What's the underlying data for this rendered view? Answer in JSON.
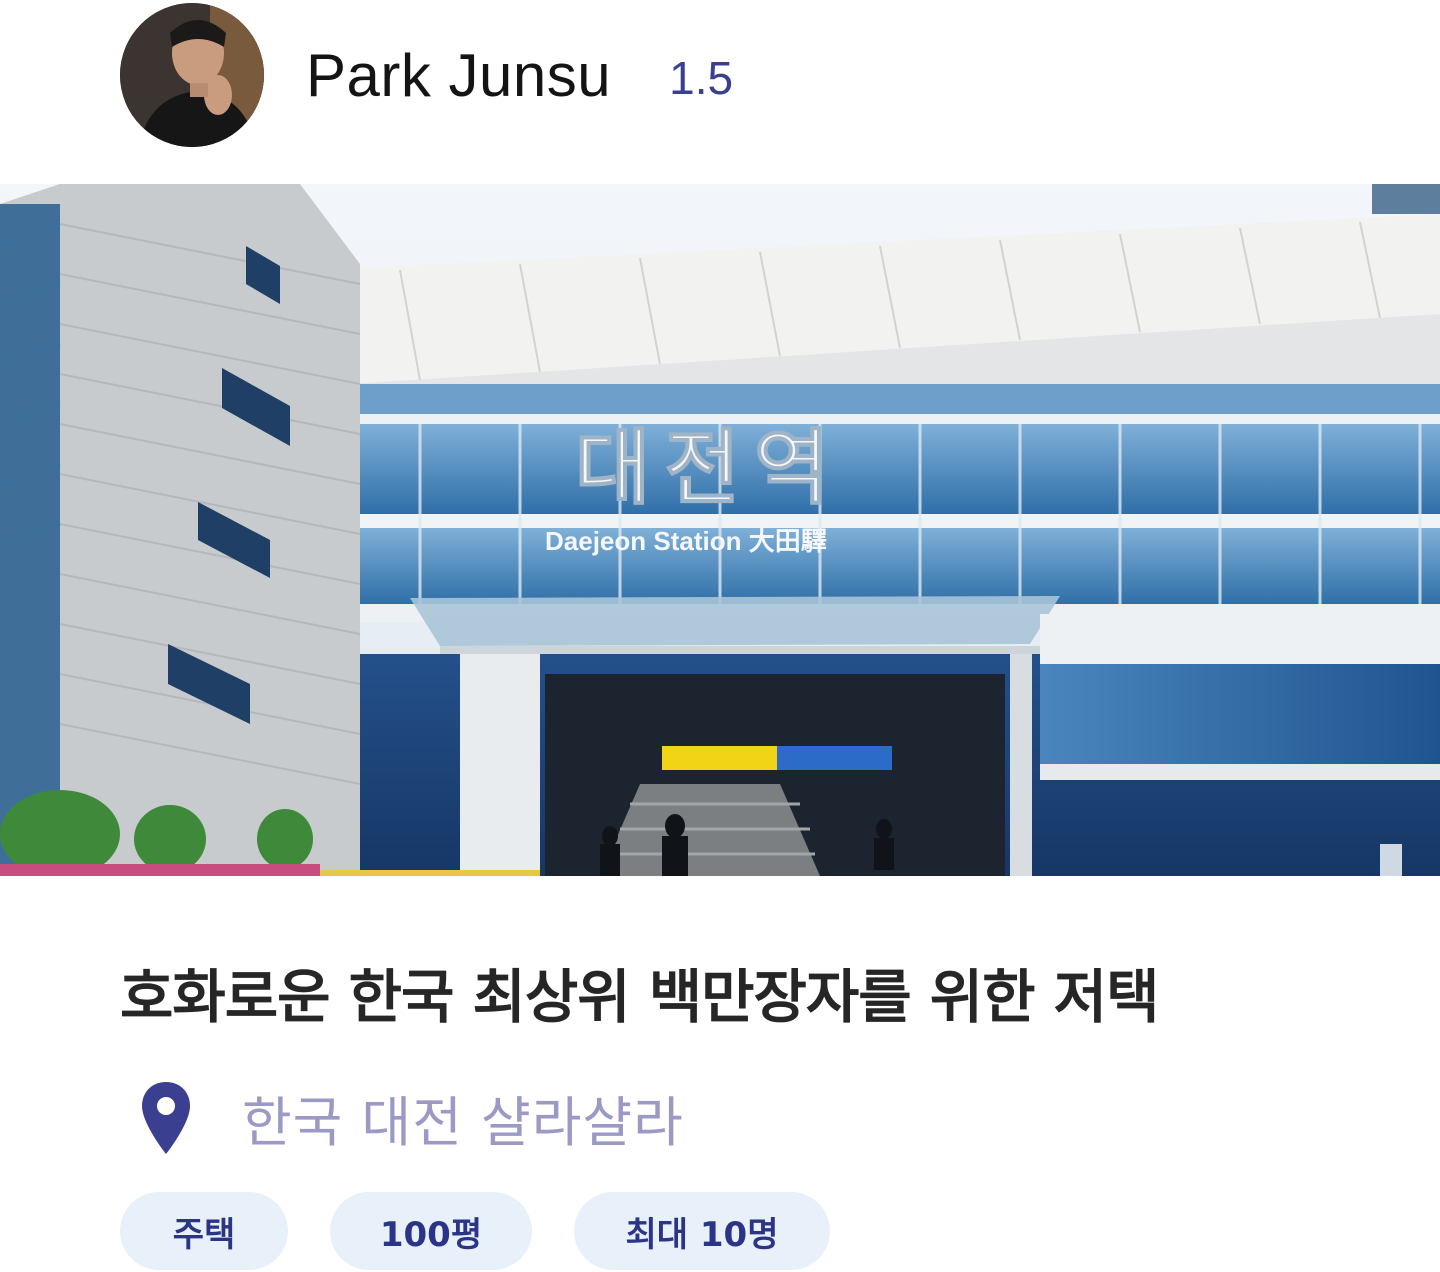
{
  "host": {
    "name": "Park Junsu",
    "rating": "1.5"
  },
  "hero": {
    "sign_korean": "대전역",
    "sign_english": "Daejeon Station 大田驛"
  },
  "listing": {
    "title": "호화로운 한국 최상위 백만장자를 위한 저택",
    "location_icon": "map-pin-icon",
    "location": "한국 대전 샬라샬라",
    "tags": [
      {
        "label": "주택"
      },
      {
        "label": "100평"
      },
      {
        "label": "최대 10명"
      }
    ]
  },
  "colors": {
    "accent": "#3a3f8f",
    "location_text": "#9b9ac4",
    "tag_bg": "#e8f0fa",
    "tag_text": "#2c3488"
  }
}
